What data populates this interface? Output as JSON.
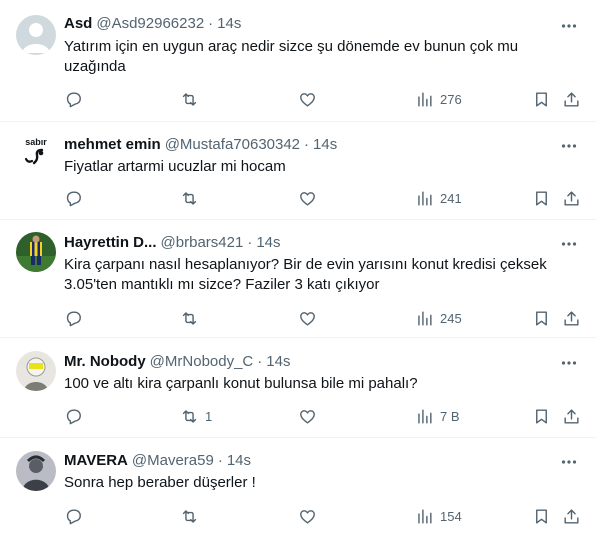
{
  "replies": [
    {
      "name": "Asd",
      "handle": "@Asd92966232",
      "dot": "·",
      "time": "14s",
      "text": "Yatırım için en uygun araç nedir sizce şu dönemde ev bunun çok mu uzağında",
      "retweets": "",
      "views": "276"
    },
    {
      "name": "mehmet emin",
      "handle": "@Mustafa70630342",
      "dot": "·",
      "time": "14s",
      "text": "Fiyatlar artarmi ucuzlar mi hocam",
      "retweets": "",
      "views": "241",
      "avatar_text": "sabır"
    },
    {
      "name": "Hayrettin D...",
      "handle": "@brbars421",
      "dot": "·",
      "time": "14s",
      "text": "Kira çarpanı nasıl hesaplanıyor? Bir de evin yarısını konut kredisi çeksek 3.05'ten mantıklı mı sizce? Faziler 3 katı çıkıyor",
      "retweets": "",
      "views": "245"
    },
    {
      "name": "Mr. Nobody",
      "handle": "@MrNobody_C",
      "dot": "·",
      "time": "14s",
      "text": "100 ve altı kira çarpanlı konut bulunsa bile mi pahalı?",
      "retweets": "1",
      "views": "7 B"
    },
    {
      "name": "MAVERA",
      "handle": "@Mavera59",
      "dot": "·",
      "time": "14s",
      "text": "Sonra hep beraber düşerler !",
      "retweets": "",
      "views": "154"
    }
  ],
  "icons": {
    "reply": "reply-icon",
    "retweet": "retweet-icon",
    "like": "like-icon",
    "views": "views-icon",
    "bookmark": "bookmark-icon",
    "share": "share-icon",
    "more": "more-icon"
  },
  "colors": {
    "text": "#0f1419",
    "secondary": "#536471",
    "divider": "#eff3f4"
  }
}
